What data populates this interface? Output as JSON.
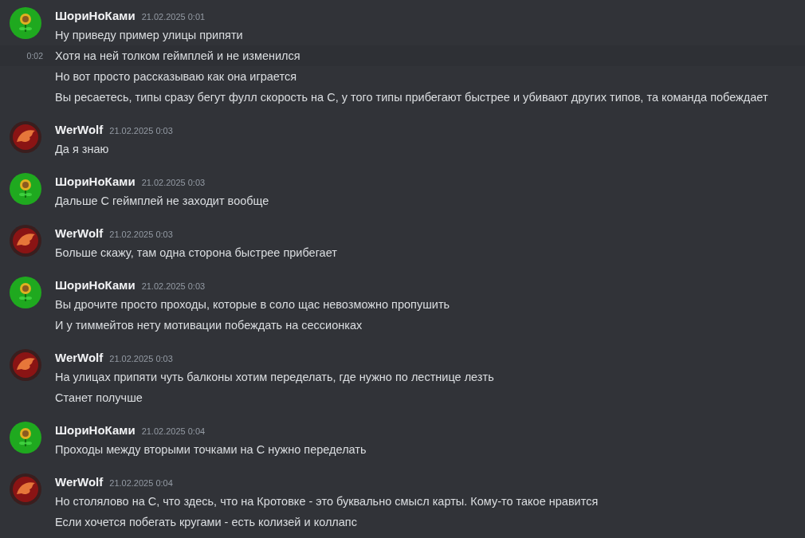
{
  "messages": [
    {
      "author": "ШориНоКами",
      "kind": "plant",
      "timestamp": "21.02.2025 0:01",
      "lines": [
        {
          "text": "Ну приведу пример улицы припяти",
          "hovered": false
        },
        {
          "text": "Хотя на ней толком геймплей и не изменился",
          "hovered": true,
          "time": "0:02"
        },
        {
          "text": "Но вот просто рассказываю как она играется",
          "hovered": false
        },
        {
          "text": "Вы ресаетесь, типы сразу бегут фулл скорость на С, у того типы прибегают быстрее и убивают других типов, та команда побеждает",
          "hovered": false
        }
      ]
    },
    {
      "author": "WerWolf",
      "kind": "beast",
      "timestamp": "21.02.2025 0:03",
      "lines": [
        {
          "text": "Да я знаю",
          "hovered": false
        }
      ]
    },
    {
      "author": "ШориНоКами",
      "kind": "plant",
      "timestamp": "21.02.2025 0:03",
      "lines": [
        {
          "text": "Дальше С геймплей не заходит вообще",
          "hovered": false
        }
      ]
    },
    {
      "author": "WerWolf",
      "kind": "beast",
      "timestamp": "21.02.2025 0:03",
      "lines": [
        {
          "text": "Больше скажу, там одна сторона быстрее прибегает",
          "hovered": false
        }
      ]
    },
    {
      "author": "ШориНоКами",
      "kind": "plant",
      "timestamp": "21.02.2025 0:03",
      "lines": [
        {
          "text": "Вы дрочите просто проходы, которые в соло щас невозможно пропушить",
          "hovered": false
        },
        {
          "text": "И у тиммейтов нету мотивации побеждать на сессионках",
          "hovered": false
        }
      ]
    },
    {
      "author": "WerWolf",
      "kind": "beast",
      "timestamp": "21.02.2025 0:03",
      "lines": [
        {
          "text": "На улицах припяти чуть балконы хотим переделать, где нужно по лестнице лезть",
          "hovered": false
        },
        {
          "text": "Станет получше",
          "hovered": false
        }
      ]
    },
    {
      "author": "ШориНоКами",
      "kind": "plant",
      "timestamp": "21.02.2025 0:04",
      "lines": [
        {
          "text": "Проходы между вторыми точками на С нужно переделать",
          "hovered": false
        }
      ]
    },
    {
      "author": "WerWolf",
      "kind": "beast",
      "timestamp": "21.02.2025 0:04",
      "lines": [
        {
          "text": "Но столялово на С, что здесь, что на Кротовке - это буквально смысл карты. Кому-то такое нравится",
          "hovered": false
        },
        {
          "text": "Если хочется побегать кругами - есть колизей и коллапс",
          "hovered": false
        }
      ]
    }
  ]
}
